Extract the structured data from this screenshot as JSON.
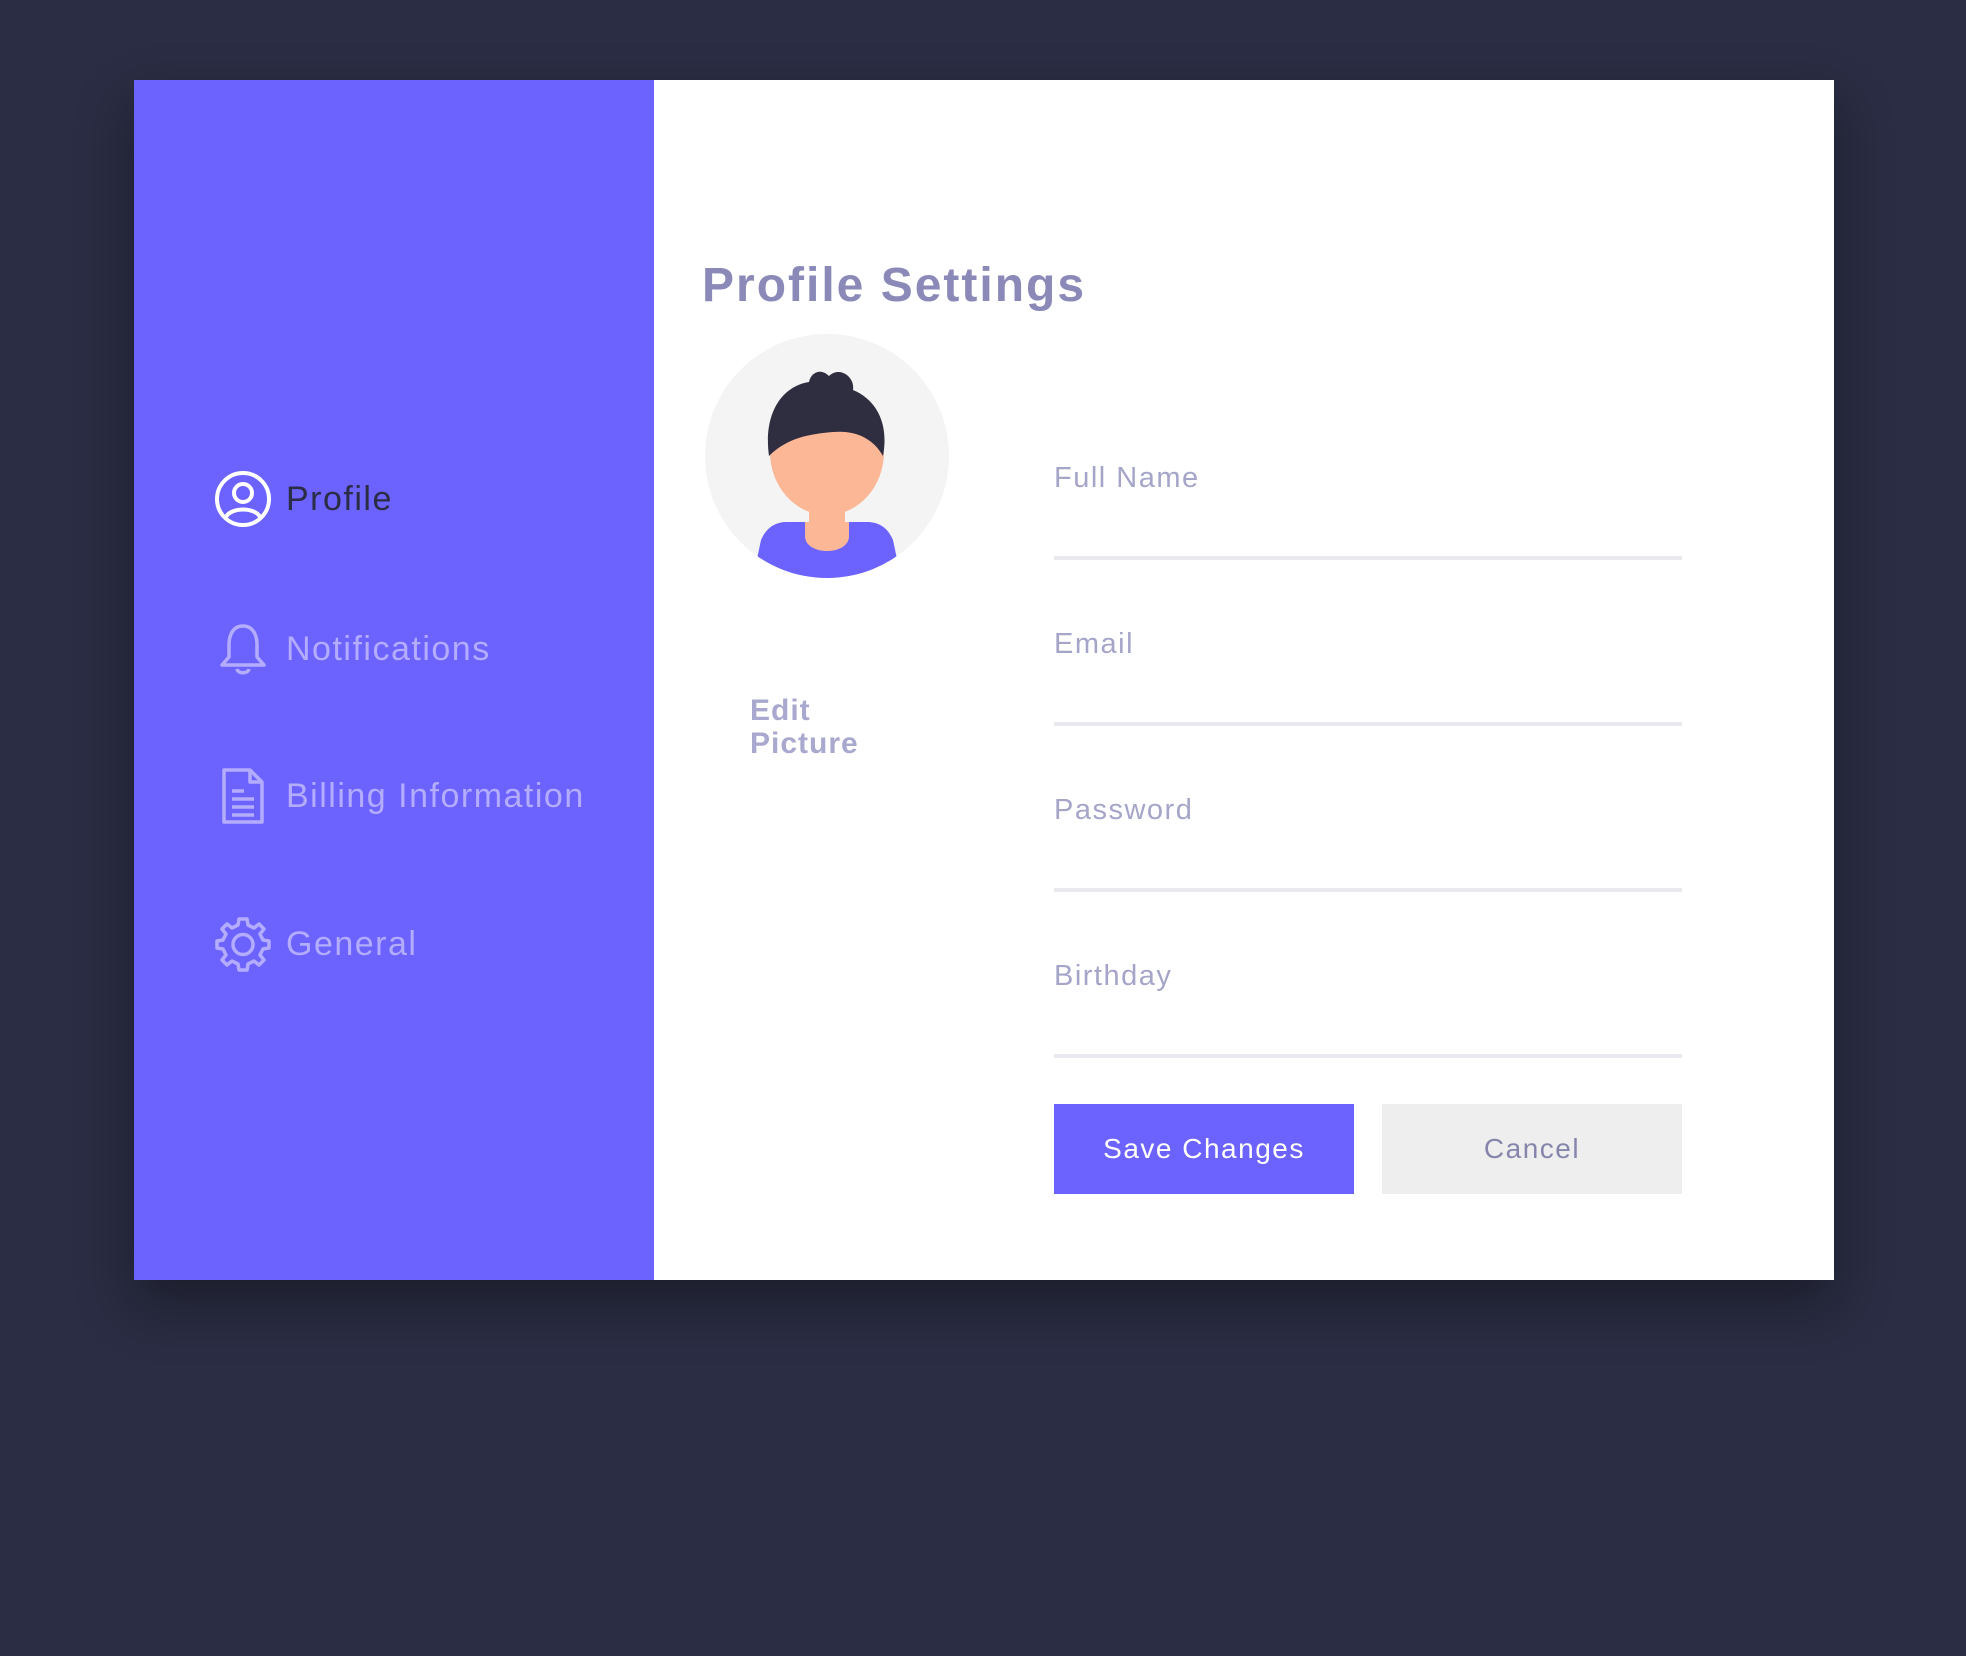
{
  "sidebar": {
    "items": [
      {
        "label": "Profile",
        "icon": "user-circle-icon",
        "active": true
      },
      {
        "label": "Notifications",
        "icon": "bell-icon",
        "active": false
      },
      {
        "label": "Billing Information",
        "icon": "document-icon",
        "active": false
      },
      {
        "label": "General",
        "icon": "gear-icon",
        "active": false
      }
    ]
  },
  "main": {
    "title": "Profile Settings",
    "avatar": {
      "icon": "avatar-illustration",
      "edit_label": "Edit Picture"
    },
    "fields": [
      {
        "label": "Full Name",
        "value": ""
      },
      {
        "label": "Email",
        "value": ""
      },
      {
        "label": "Password",
        "value": ""
      },
      {
        "label": "Birthday",
        "value": ""
      }
    ],
    "buttons": {
      "save_label": "Save Changes",
      "cancel_label": "Cancel"
    }
  },
  "colors": {
    "background": "#2a2d43",
    "sidebar": "#6c63ff",
    "accent": "#6c63ff",
    "nav_inactive": "#b3acff",
    "nav_active": "#2a2d43",
    "title": "#8a89b8",
    "field_label": "#a5a5c9",
    "cancel_bg": "#eeeeee"
  }
}
